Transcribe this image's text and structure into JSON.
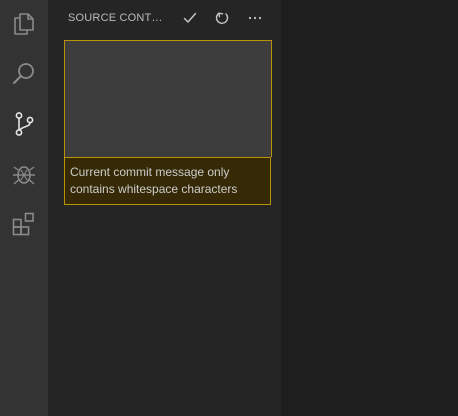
{
  "activity_bar": {
    "items": [
      {
        "icon": "files-icon",
        "active": false
      },
      {
        "icon": "search-icon",
        "active": false
      },
      {
        "icon": "source-control-icon",
        "active": true
      },
      {
        "icon": "debug-icon",
        "active": false
      },
      {
        "icon": "extensions-icon",
        "active": false
      }
    ]
  },
  "side_bar": {
    "title": "SOURCE CONTROL",
    "actions": [
      {
        "icon": "commit-check-icon"
      },
      {
        "icon": "refresh-icon"
      },
      {
        "icon": "more-icon"
      }
    ]
  },
  "commit": {
    "value": "",
    "placeholder": "",
    "validation_message": "Current commit message only contains whitespace characters"
  },
  "colors": {
    "activity_bar_bg": "#333333",
    "side_bar_bg": "#252526",
    "editor_bg": "#1e1e1e",
    "input_bg": "#3c3c3c",
    "warning_border": "#b89500",
    "warning_bg": "#352a05"
  }
}
